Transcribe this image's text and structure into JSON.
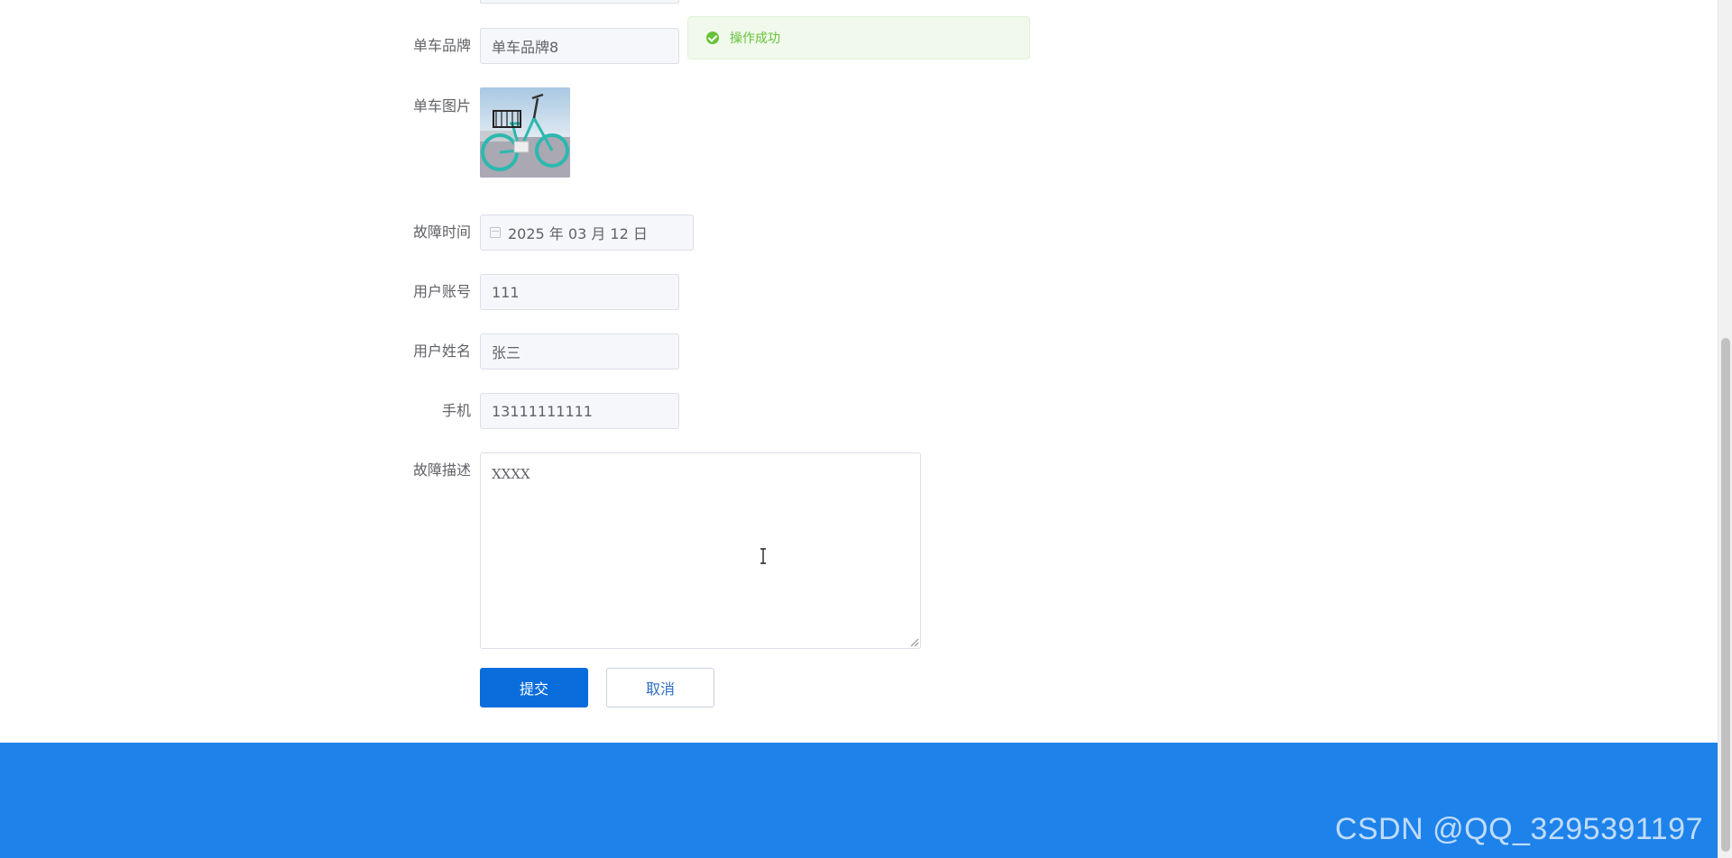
{
  "form": {
    "brand": {
      "label": "单车品牌",
      "value": "单车品牌8"
    },
    "picture": {
      "label": "单车图片"
    },
    "fault_time": {
      "label": "故障时间",
      "value": "2025 年 03 月 12 日"
    },
    "user_account": {
      "label": "用户账号",
      "value": "111"
    },
    "user_name": {
      "label": "用户姓名",
      "value": "张三"
    },
    "phone": {
      "label": "手机",
      "value": "13111111111"
    },
    "description": {
      "label": "故障描述",
      "value": "XXXX"
    }
  },
  "buttons": {
    "submit": "提交",
    "cancel": "取消"
  },
  "toast": {
    "message": "操作成功",
    "icon": "check-circle-icon",
    "color": "#67c23a"
  },
  "colors": {
    "primary": "#0a6ddc",
    "footer": "#1e82eb",
    "success": "#67c23a"
  },
  "watermark": "CSDN @QQ_3295391197"
}
